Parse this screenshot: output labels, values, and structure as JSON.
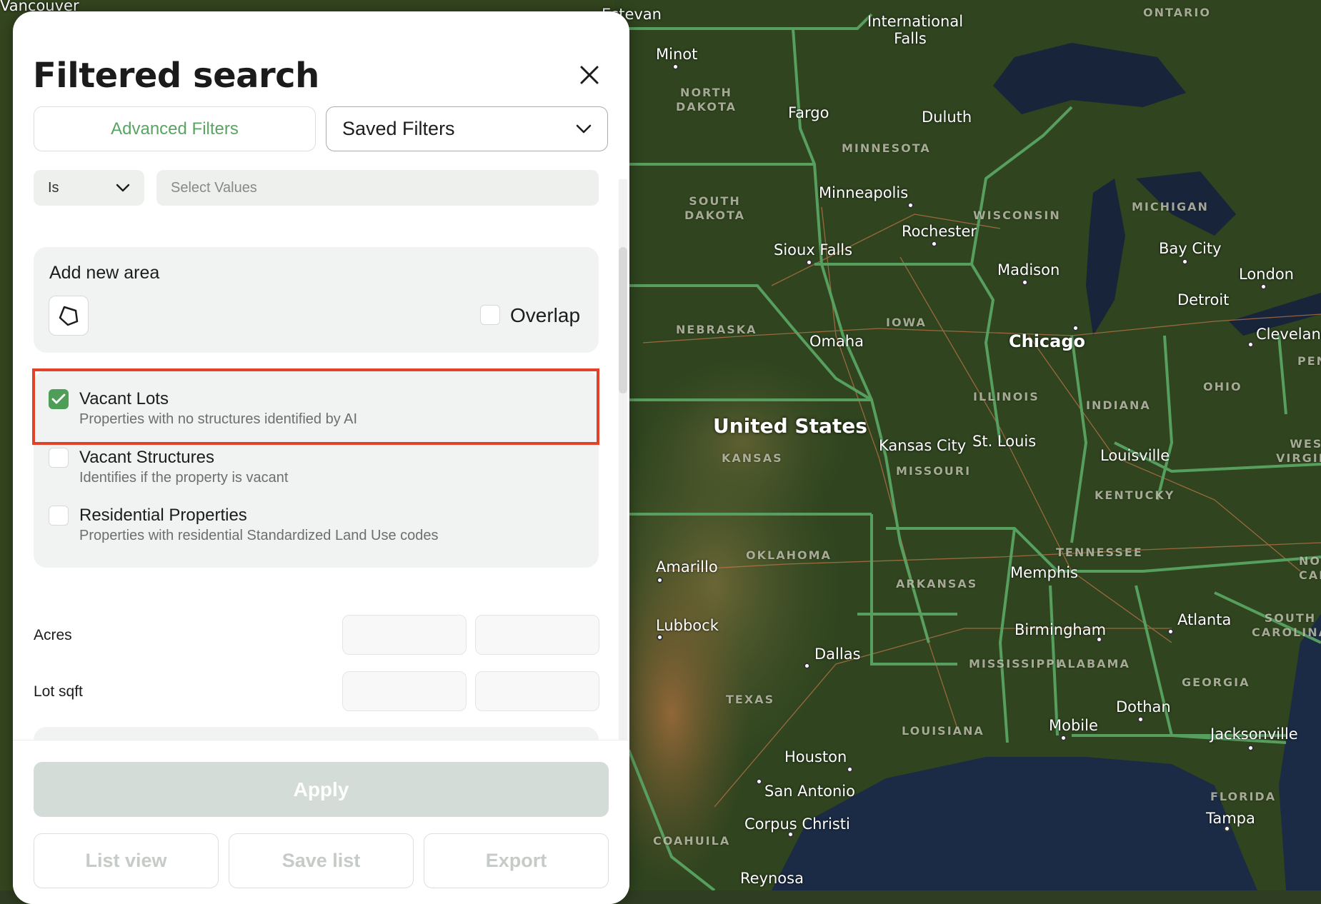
{
  "panel": {
    "title": "Filtered search",
    "tabs": {
      "advanced": "Advanced Filters",
      "saved": "Saved Filters"
    },
    "condition": {
      "operator": "Is",
      "values_placeholder": "Select Values"
    },
    "area": {
      "title": "Add new area",
      "overlap_label": "Overlap",
      "overlap_checked": false
    },
    "options": [
      {
        "title": "Vacant Lots",
        "desc": "Properties with no structures identified by AI",
        "checked": true
      },
      {
        "title": "Vacant Structures",
        "desc": "Identifies if the property is vacant",
        "checked": false
      },
      {
        "title": "Residential Properties",
        "desc": "Properties with residential Standardized Land Use codes",
        "checked": false
      }
    ],
    "ranges": {
      "acres": "Acres",
      "lot_sqft": "Lot sqft"
    },
    "footer": {
      "apply": "Apply",
      "list_view": "List view",
      "save_list": "Save list",
      "export": "Export"
    }
  },
  "map": {
    "country": "United States",
    "cities": {
      "vancouver": "Vancouver",
      "estevan": "Estevan",
      "minot": "Minot",
      "intl_falls": "International Falls",
      "fargo": "Fargo",
      "duluth": "Duluth",
      "minneapolis": "Minneapolis",
      "rochester": "Rochester",
      "sioux_falls": "Sioux Falls",
      "madison": "Madison",
      "bay_city": "Bay City",
      "london": "London",
      "detroit": "Detroit",
      "chicago": "Chicago",
      "cleveland": "Cleveland",
      "omaha": "Omaha",
      "kansas_city": "Kansas City",
      "st_louis": "St. Louis",
      "louisville": "Louisville",
      "amarillo": "Amarillo",
      "memphis": "Memphis",
      "lubbock": "Lubbock",
      "birmingham": "Birmingham",
      "atlanta": "Atlanta",
      "dallas": "Dallas",
      "dothan": "Dothan",
      "mobile": "Mobile",
      "jacksonville": "Jacksonville",
      "houston": "Houston",
      "san_antonio": "San Antonio",
      "corpus_christi": "Corpus Christi",
      "tampa": "Tampa",
      "reynosa": "Reynosa"
    },
    "states": {
      "ontario": "ONTARIO",
      "north_dakota": "NORTH\nDAKOTA",
      "minnesota": "MINNESOTA",
      "south_dakota": "SOUTH\nDAKOTA",
      "wisconsin": "WISCONSIN",
      "michigan": "MICHIGAN",
      "nebraska": "NEBRASKA",
      "iowa": "IOWA",
      "illinois": "ILLINOIS",
      "indiana": "INDIANA",
      "ohio": "OHIO",
      "west_virginia": "WEST\nVIRGINIA",
      "kansas": "KANSAS",
      "missouri": "MISSOURI",
      "kentucky": "KENTUCKY",
      "oklahoma": "OKLAHOMA",
      "tennessee": "TENNESSEE",
      "arkansas": "ARKANSAS",
      "south_carolina": "SOUTH\nCAROLINA",
      "alabama": "ALABAMA",
      "mississippi": "MISSISSIPPI",
      "georgia": "GEORGIA",
      "texas": "TEXAS",
      "louisiana": "LOUISIANA",
      "florida": "FLORIDA",
      "coahuila": "COAHUILA",
      "pennsylvania_fragment": "PEN",
      "north_carolina_fragment": "NOR\nCARO"
    }
  },
  "colors": {
    "accent": "#4f9e57",
    "highlight": "#e2412a",
    "border_green": "#5aa463"
  }
}
